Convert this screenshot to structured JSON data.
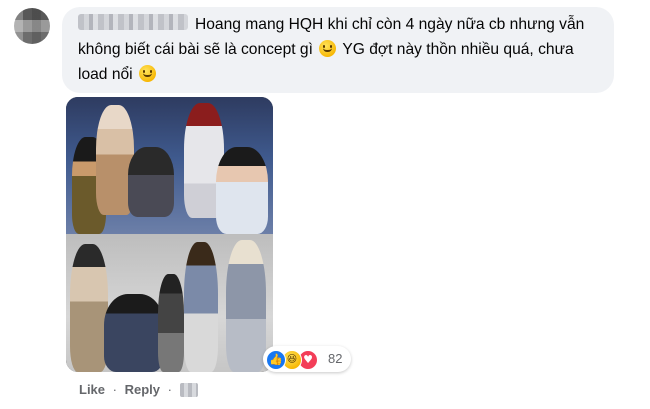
{
  "comment": {
    "text": "Hoang mang HQH khi chỉ còn 4 ngày nữa cb nhưng vẫn không biết cái bài sẽ là concept gì",
    "text_part2": "YG đợt này thồn nhiều quá, chưa load nổi",
    "emoji": "slightly-smiling-face-icon"
  },
  "reactions": {
    "count": "82",
    "icons": [
      "like-icon",
      "haha-icon",
      "love-icon"
    ],
    "colors": {
      "like": "#1877f2",
      "love": "#f33e58",
      "haha": "#f7b500"
    }
  },
  "actions": {
    "like_label": "Like",
    "separator": "·",
    "reply_label": "Reply"
  },
  "colors": {
    "bubble_bg": "#f0f2f5",
    "meta_text": "#65676b"
  }
}
